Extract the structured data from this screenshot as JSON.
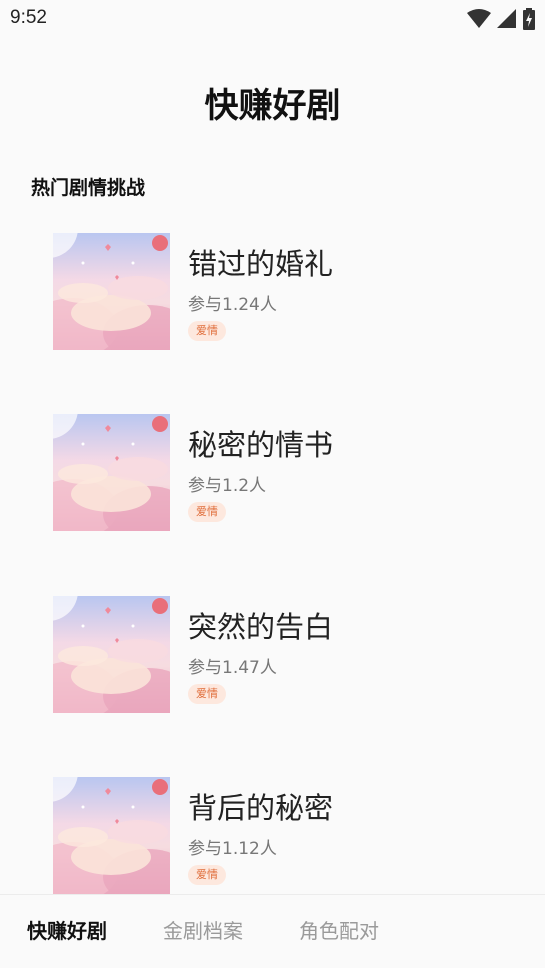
{
  "status_bar": {
    "time": "9:52",
    "icons": [
      "wifi-icon",
      "signal-icon",
      "battery-charging-icon"
    ]
  },
  "header": {
    "title": "快赚好剧"
  },
  "section": {
    "title": "热门剧情挑战"
  },
  "dramas": [
    {
      "title": "错过的婚礼",
      "participants": "参与1.24人",
      "tag": "爱情"
    },
    {
      "title": "秘密的情书",
      "participants": "参与1.2人",
      "tag": "爱情"
    },
    {
      "title": "突然的告白",
      "participants": "参与1.47人",
      "tag": "爱情"
    },
    {
      "title": "背后的秘密",
      "participants": "参与1.12人",
      "tag": "爱情"
    }
  ],
  "bottom_nav": {
    "tabs": [
      {
        "label": "快赚好剧",
        "active": true
      },
      {
        "label": "金剧档案",
        "active": false
      },
      {
        "label": "角色配对",
        "active": false
      }
    ]
  },
  "colors": {
    "tag_text": "#e06d3a",
    "tag_bg": "#fde8de",
    "active_tab": "#111111",
    "inactive_tab": "#9a9a9a"
  }
}
